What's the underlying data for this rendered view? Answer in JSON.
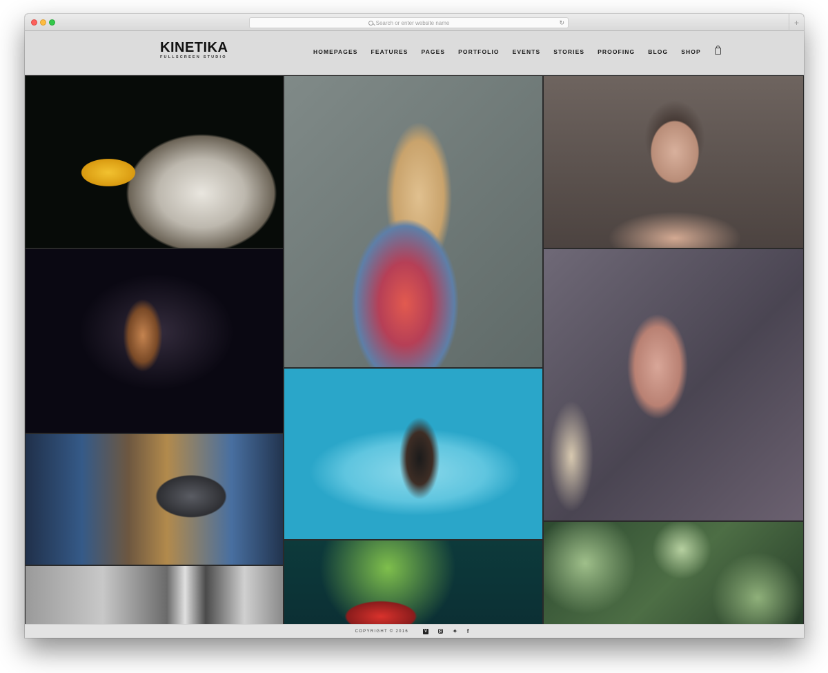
{
  "browser": {
    "address_placeholder": "Search or enter website name",
    "reload_glyph": "↻",
    "new_tab_glyph": "+"
  },
  "site": {
    "logo": "KINETIKA",
    "tagline": "FULLSCREEN STUDIO",
    "nav": [
      {
        "label": "HOMEPAGES"
      },
      {
        "label": "FEATURES"
      },
      {
        "label": "PAGES"
      },
      {
        "label": "PORTFOLIO"
      },
      {
        "label": "EVENTS"
      },
      {
        "label": "STORIES"
      },
      {
        "label": "PROOFING"
      },
      {
        "label": "BLOG"
      },
      {
        "label": "SHOP"
      }
    ],
    "cart_icon": "shopping-bag-icon"
  },
  "gallery": {
    "tiles": [
      {
        "subject": "bald eagle portrait"
      },
      {
        "subject": "hand in dust particles"
      },
      {
        "subject": "hands holding camera"
      },
      {
        "subject": "black and white buildings"
      },
      {
        "subject": "woman in plaid shirt profile"
      },
      {
        "subject": "woman lying in blue pool"
      },
      {
        "subject": "red umbrella city lights"
      },
      {
        "subject": "woman portrait"
      },
      {
        "subject": "hand on rainy window"
      },
      {
        "subject": "green leaves"
      }
    ]
  },
  "footer": {
    "copyright": "COPYRIGHT © 2016",
    "social": {
      "vimeo": "V",
      "twitter": "🐦",
      "facebook": "f"
    }
  }
}
